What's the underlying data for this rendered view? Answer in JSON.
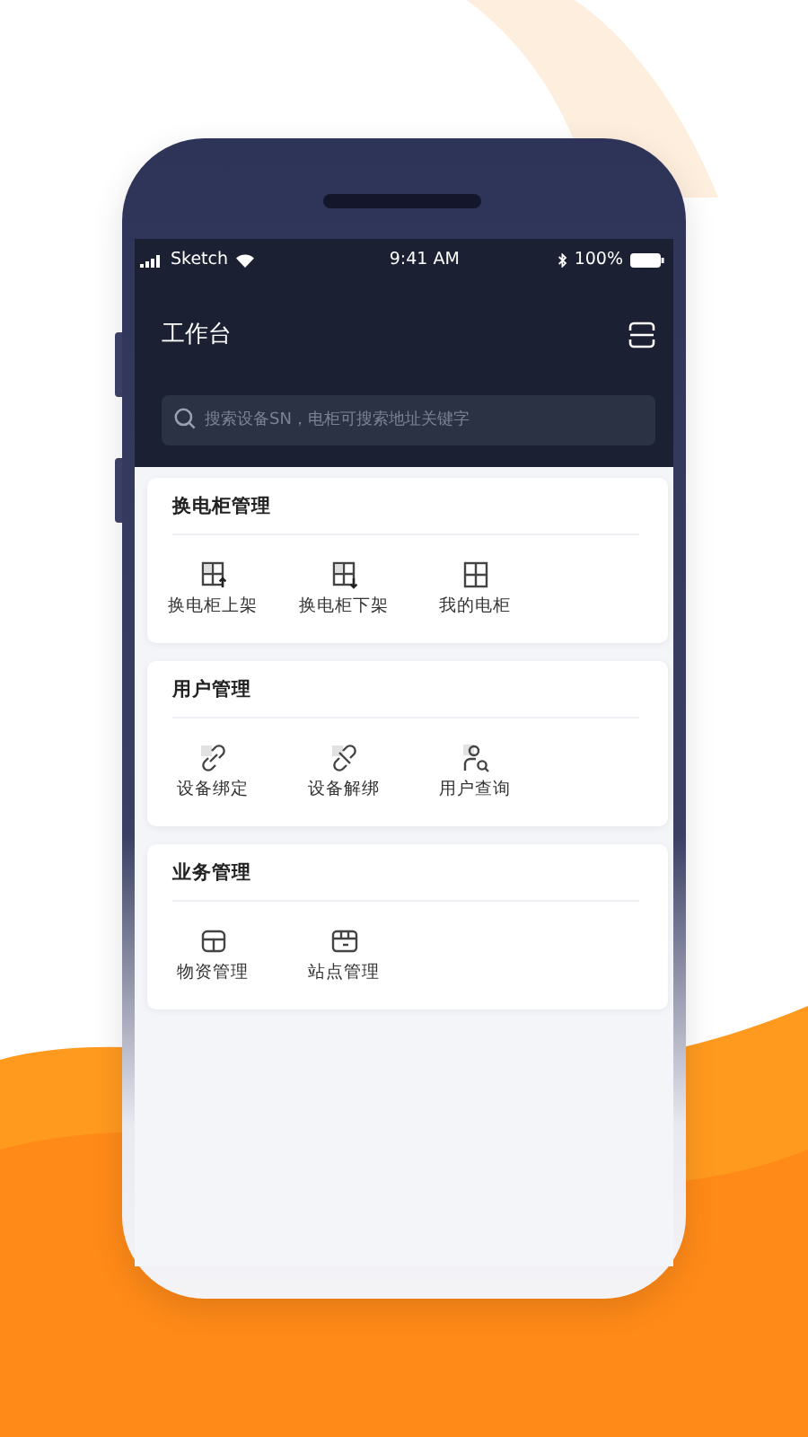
{
  "status_bar": {
    "carrier": "Sketch",
    "time": "9:41 AM",
    "battery": "100%"
  },
  "header": {
    "title": "工作台",
    "search": {
      "placeholder": "搜索设备SN，电柜可搜索地址关键字"
    }
  },
  "sections": [
    {
      "title": "换电柜管理",
      "items": [
        {
          "label": "换电柜上架"
        },
        {
          "label": "换电柜下架"
        },
        {
          "label": "我的电柜"
        }
      ]
    },
    {
      "title": "用户管理",
      "items": [
        {
          "label": "设备绑定"
        },
        {
          "label": "设备解绑"
        },
        {
          "label": "用户查询"
        }
      ]
    },
    {
      "title": "业务管理",
      "items": [
        {
          "label": "物资管理"
        },
        {
          "label": "站点管理"
        }
      ]
    }
  ]
}
